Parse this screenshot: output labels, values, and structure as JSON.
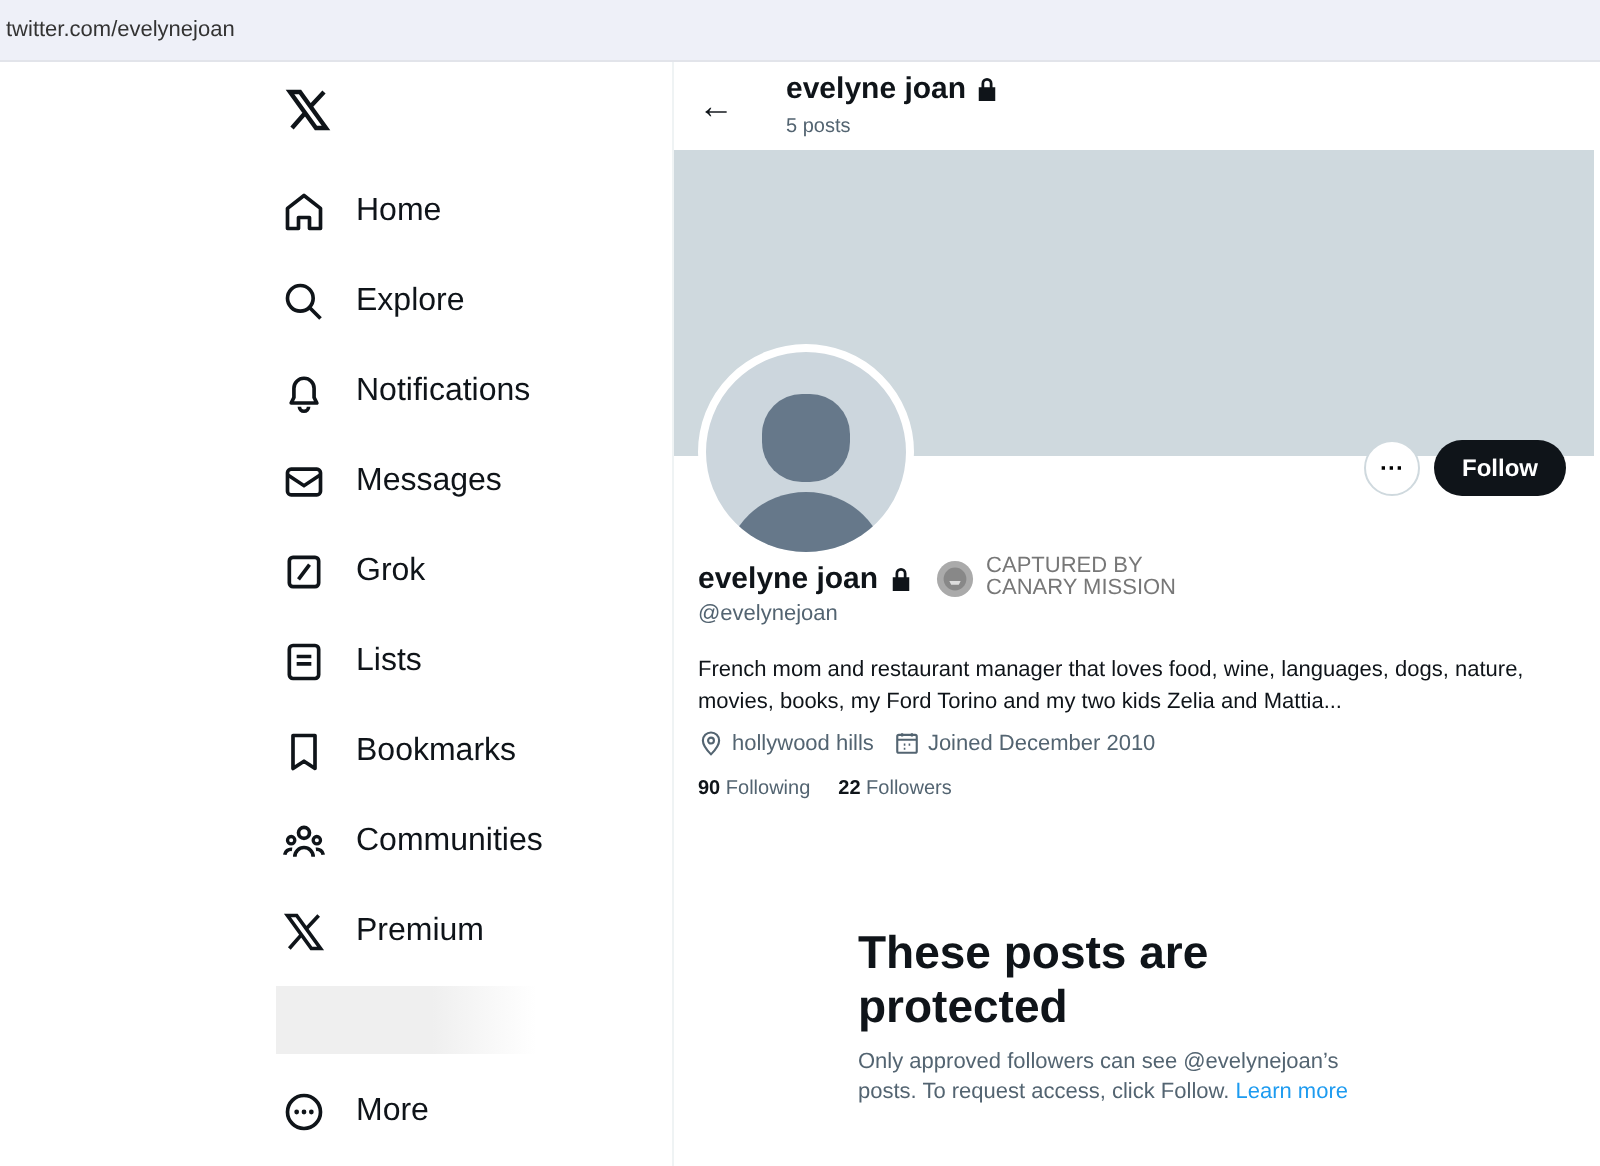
{
  "address_bar": {
    "url": "twitter.com/evelynejoan"
  },
  "sidebar": {
    "items": [
      {
        "kind": "home",
        "label": "Home"
      },
      {
        "kind": "explore",
        "label": "Explore"
      },
      {
        "kind": "notifications",
        "label": "Notifications"
      },
      {
        "kind": "messages",
        "label": "Messages"
      },
      {
        "kind": "grok",
        "label": "Grok"
      },
      {
        "kind": "lists",
        "label": "Lists"
      },
      {
        "kind": "bookmarks",
        "label": "Bookmarks"
      },
      {
        "kind": "communities",
        "label": "Communities"
      },
      {
        "kind": "premium",
        "label": "Premium"
      },
      {
        "kind": "redacted"
      },
      {
        "kind": "more",
        "label": "More"
      }
    ]
  },
  "header": {
    "back": "←",
    "name": "evelyne joan",
    "post_count": "5 posts"
  },
  "profile": {
    "more_button": "···",
    "follow_button": "Follow",
    "name": "evelyne joan",
    "badge": [
      "CAPTURED BY",
      "CANARY MISSION"
    ],
    "handle": "@evelynejoan",
    "bio": "French mom and restaurant manager that loves food, wine, languages, dogs, nature, movies, books, my Ford Torino  and my two kids Zelia and Mattia...",
    "location": "hollywood hills",
    "joined": "Joined December 2010",
    "following_count": "90",
    "following_label": "Following",
    "followers_count": "22",
    "followers_label": "Followers"
  },
  "protected": {
    "title": "These posts are protected",
    "text": "Only approved followers can see @evelynejoan’s posts. To request access, click Follow.",
    "link": "Learn more"
  }
}
